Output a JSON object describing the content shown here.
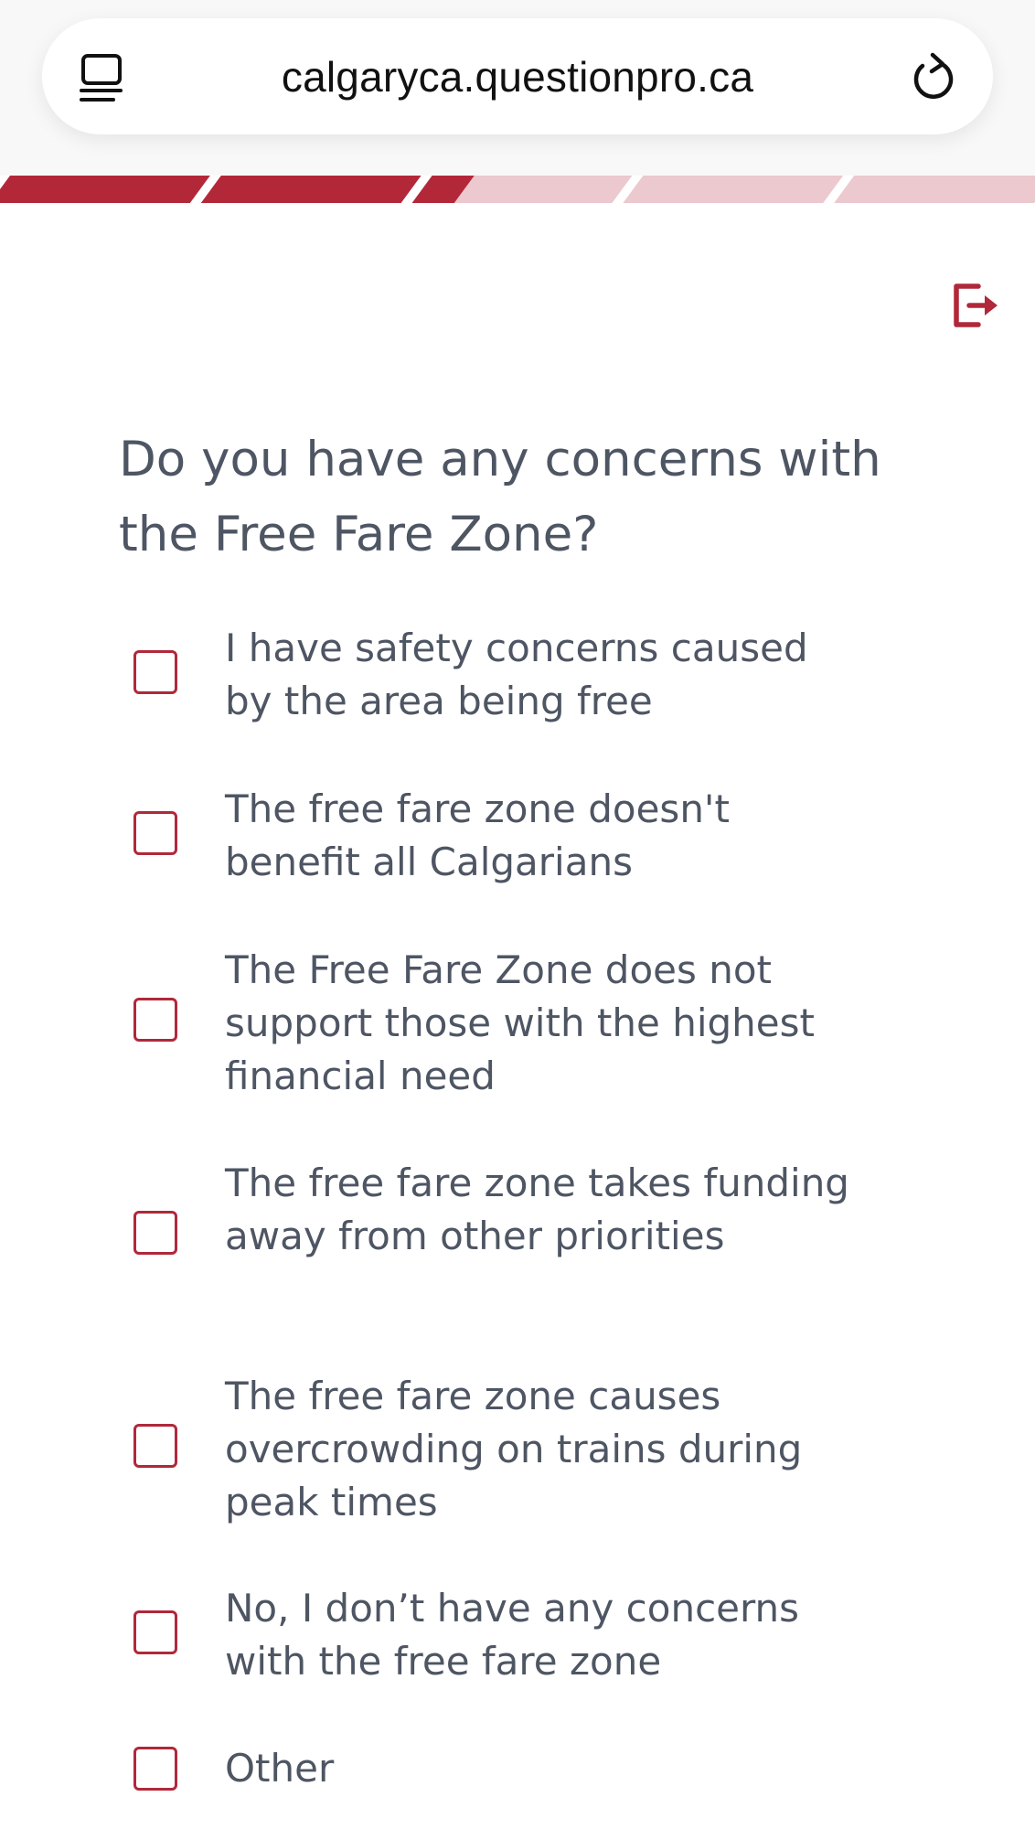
{
  "browser": {
    "url": "calgaryca.questionpro.ca",
    "tabs_icon": "tabs-icon",
    "reload_icon": "reload-icon"
  },
  "progress": {
    "segments_total": 5,
    "segments_completed": 2,
    "current_segment_fraction": 0.2,
    "complete_color": "#b32838",
    "incomplete_color": "#ecc8cf"
  },
  "header": {
    "exit_icon": "exit-icon",
    "accent_color": "#b0283a"
  },
  "question": {
    "title": "Do you have any concerns with the Free Fare Zone?",
    "options": [
      {
        "label": "I have safety concerns caused by the area being free",
        "checked": false
      },
      {
        "label": "The free fare zone doesn't benefit all Calgarians",
        "checked": false
      },
      {
        "label": "The Free Fare Zone does not support those with the highest financial need",
        "checked": false
      },
      {
        "label": "The free fare zone takes funding away from other priorities",
        "checked": false
      },
      {
        "label": "The free fare zone causes overcrowding on trains during peak times",
        "checked": false
      },
      {
        "label": "No, I don’t have any concerns with the free fare zone",
        "checked": false
      },
      {
        "label": "Other",
        "checked": false
      }
    ]
  }
}
